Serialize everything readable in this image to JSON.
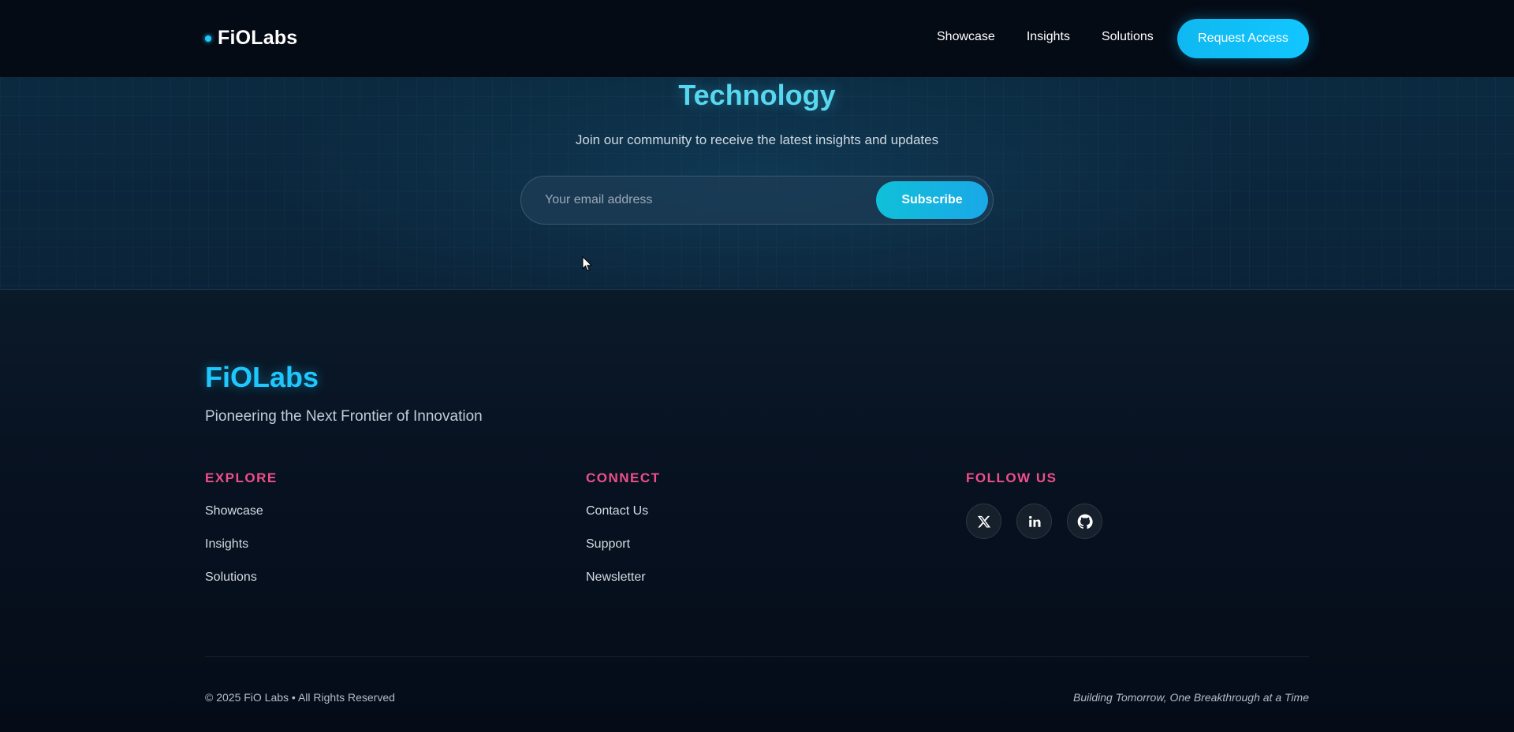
{
  "header": {
    "brand": "FiOLabs",
    "nav": [
      "Showcase",
      "Insights",
      "Solutions"
    ],
    "cta_label": "Request Access"
  },
  "newsletter": {
    "title": "Technology",
    "subtitle": "Join our community to receive the latest insights and updates",
    "email_placeholder": "Your email address",
    "subscribe_label": "Subscribe"
  },
  "footer": {
    "brand": "FiOLabs",
    "tagline": "Pioneering the Next Frontier of Innovation",
    "explore": {
      "heading": "EXPLORE",
      "links": [
        "Showcase",
        "Insights",
        "Solutions"
      ]
    },
    "connect": {
      "heading": "CONNECT",
      "links": [
        "Contact Us",
        "Support",
        "Newsletter"
      ]
    },
    "follow": {
      "heading": "FOLLOW US",
      "icons": [
        "x-twitter-icon",
        "linkedin-icon",
        "github-icon"
      ]
    },
    "copyright": "© 2025 FiO Labs • All Rights Reserved",
    "motto": "Building Tomorrow, One Breakthrough at a Time"
  },
  "colors": {
    "accent": "#1ec8ff",
    "heading_pink": "#ef4f8a",
    "title_cyan": "#57d8f0",
    "background": "#060d1a"
  }
}
